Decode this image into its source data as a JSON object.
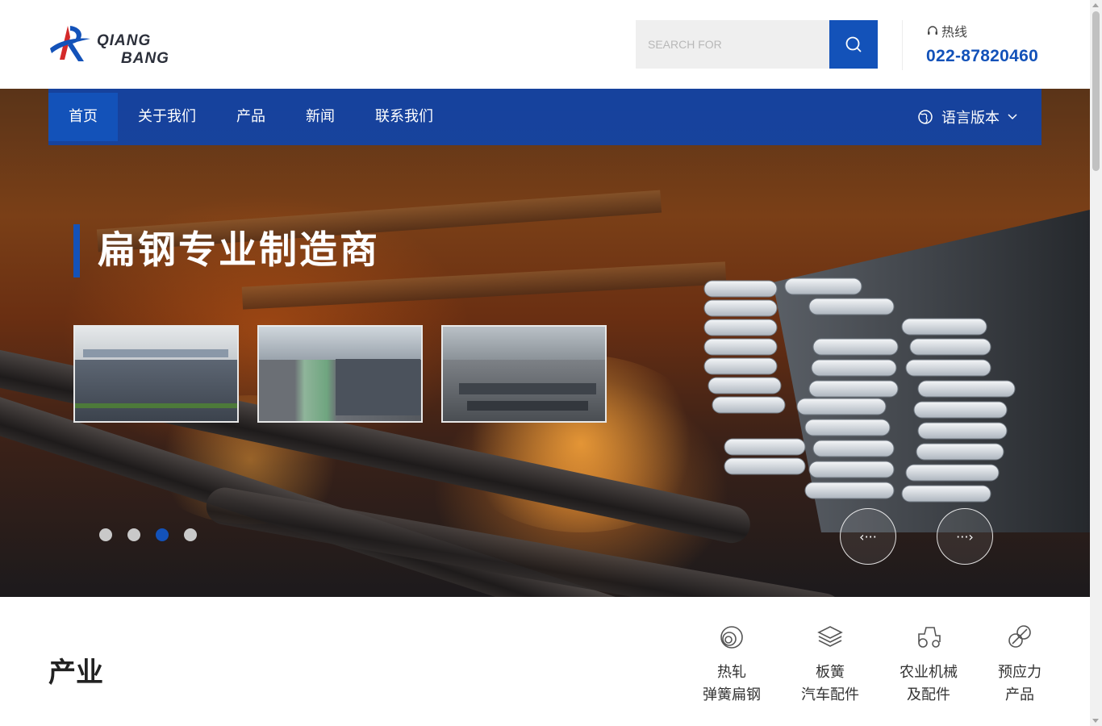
{
  "brand": {
    "line1": "QIANG",
    "line2": "BANG",
    "colors": {
      "blue": "#1352b9",
      "red": "#d42a2a"
    }
  },
  "search": {
    "placeholder": "SEARCH FOR",
    "button_icon": "search-icon"
  },
  "hotline": {
    "label": "热线",
    "number": "022-87820460",
    "icon": "headset-icon"
  },
  "nav": {
    "items": [
      {
        "label": "首页",
        "active": true
      },
      {
        "label": "关于我们",
        "active": false
      },
      {
        "label": "产品",
        "active": false
      },
      {
        "label": "新闻",
        "active": false
      },
      {
        "label": "联系我们",
        "active": false
      }
    ],
    "language": {
      "label": "语言版本",
      "icon": "globe-icon"
    }
  },
  "hero": {
    "headline": "扁钢专业制造商",
    "slide_count": 4,
    "active_slide": 3,
    "prev_label": "‹···",
    "next_label": "···›"
  },
  "industry": {
    "title": "产业",
    "items": [
      {
        "line1": "热轧",
        "line2": "弹簧扁钢",
        "icon": "coil-icon"
      },
      {
        "line1": "板簧",
        "line2": "汽车配件",
        "icon": "leaf-spring-icon"
      },
      {
        "line1": "农业机械",
        "line2": "及配件",
        "icon": "tractor-icon"
      },
      {
        "line1": "预应力",
        "line2": "产品",
        "icon": "prestressed-icon"
      }
    ]
  }
}
